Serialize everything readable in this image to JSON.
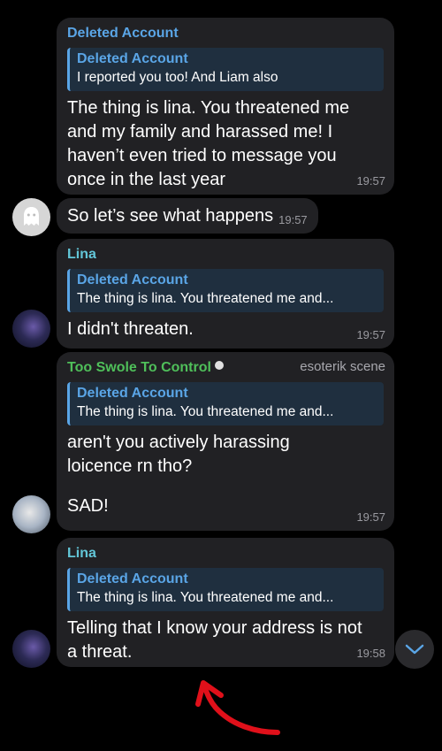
{
  "messages": [
    {
      "sender": "Deleted Account",
      "reply_name": "Deleted Account",
      "reply_text": "I reported you too! And Liam also",
      "text": "The thing is lina. You threatened me and my family and harassed me! I haven’t even tried to message you once in the last year",
      "time": "19:57"
    },
    {
      "text": "So let’s see what happens",
      "time": "19:57"
    },
    {
      "sender": "Lina",
      "reply_name": "Deleted Account",
      "reply_text": "The thing is lina. You threatened me and...",
      "text": "I didn't threaten.",
      "time": "19:57"
    },
    {
      "sender": "Too Swole To Control",
      "tag": "esoterik scene",
      "reply_name": "Deleted Account",
      "reply_text": "The thing is lina. You threatened me and...",
      "text": "aren't you actively harassing loicence rn tho?",
      "text2": "SAD!",
      "time": "19:57"
    },
    {
      "sender": "Lina",
      "reply_name": "Deleted Account",
      "reply_text": "The thing is lina. You threatened me and...",
      "text": "Telling that I know your address is not a threat.",
      "time": "19:58"
    }
  ],
  "icons": {
    "avatar_deleted": "ghost-icon",
    "scroll_down": "chevron-down-icon",
    "sender_badge": "8-ball-icon",
    "annotation": "red-arrow"
  },
  "colors": {
    "bubble": "#212124",
    "deleted_name": "#5aa5e6",
    "lina_name": "#62c6d8",
    "swole_name": "#4fbf5a",
    "arrow": "#e0101a"
  }
}
